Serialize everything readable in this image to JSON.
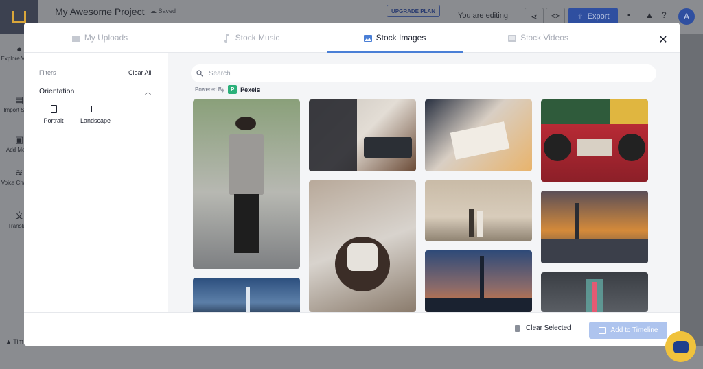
{
  "app": {
    "project_title": "My Awesome Project",
    "saved_status": "Saved",
    "upgrade_label": "UPGRADE PLAN",
    "editing_text": "You are editing",
    "export_label": "Export",
    "avatar_initial": "A",
    "sidebar": [
      "Explore Voices",
      "Import Script",
      "Add Media",
      "Voice Changer",
      "Translate"
    ],
    "timeline_label": "Tim"
  },
  "modal": {
    "tabs": [
      {
        "label": "My Uploads",
        "icon": "upload-folder-icon",
        "active": false
      },
      {
        "label": "Stock Music",
        "icon": "music-note-icon",
        "active": false
      },
      {
        "label": "Stock Images",
        "icon": "image-icon",
        "active": true
      },
      {
        "label": "Stock Videos",
        "icon": "video-icon",
        "active": false
      }
    ],
    "close_icon": "close-icon",
    "filters": {
      "title": "Filters",
      "clear_all": "Clear All",
      "orientation_label": "Orientation",
      "options": [
        {
          "label": "Portrait",
          "icon": "portrait-icon"
        },
        {
          "label": "Landscape",
          "icon": "landscape-icon"
        }
      ]
    },
    "search": {
      "placeholder": "Search",
      "value": ""
    },
    "powered_by": {
      "label": "Powered By",
      "provider": "Pexels",
      "logo_letter": "P"
    },
    "footer": {
      "clear_selected": "Clear Selected",
      "add_to_timeline": "Add to Timeline"
    }
  },
  "photos": [
    {
      "name": "photo-man-checked-blazer",
      "colors": [
        "#8aa07a",
        "#b7b8b2",
        "#7d7f82"
      ]
    },
    {
      "name": "photo-people-writing-table",
      "colors": [
        "#c9c4bd",
        "#1e2027",
        "#6b4b37"
      ]
    },
    {
      "name": "photo-hands-drawing-paper",
      "colors": [
        "#d9cfc4",
        "#283040",
        "#e8b36b"
      ]
    },
    {
      "name": "photo-retro-radio",
      "colors": [
        "#2f5b3b",
        "#b82a35",
        "#e0b640"
      ]
    },
    {
      "name": "photo-rotary-phone-terrazzo",
      "colors": [
        "#b8a99a",
        "#3b2d27",
        "#d8d3cd"
      ]
    },
    {
      "name": "photo-couple-ruins",
      "colors": [
        "#c9bba7",
        "#8e8271",
        "#3b352f"
      ]
    },
    {
      "name": "photo-city-sunset",
      "colors": [
        "#d48a3a",
        "#3b3f4a",
        "#7b5a4a"
      ]
    },
    {
      "name": "photo-taipei-tower-dusk",
      "colors": [
        "#2e4a78",
        "#e07a3a",
        "#1a2230"
      ]
    },
    {
      "name": "photo-taipei-night-skyline",
      "colors": [
        "#2c4f7e",
        "#5c7fa8",
        "#1a2a40"
      ]
    },
    {
      "name": "photo-tower-foggy",
      "colors": [
        "#3a3e44",
        "#e45a73",
        "#62a6a0"
      ]
    }
  ],
  "chat_icon": "chat-bubble-icon"
}
